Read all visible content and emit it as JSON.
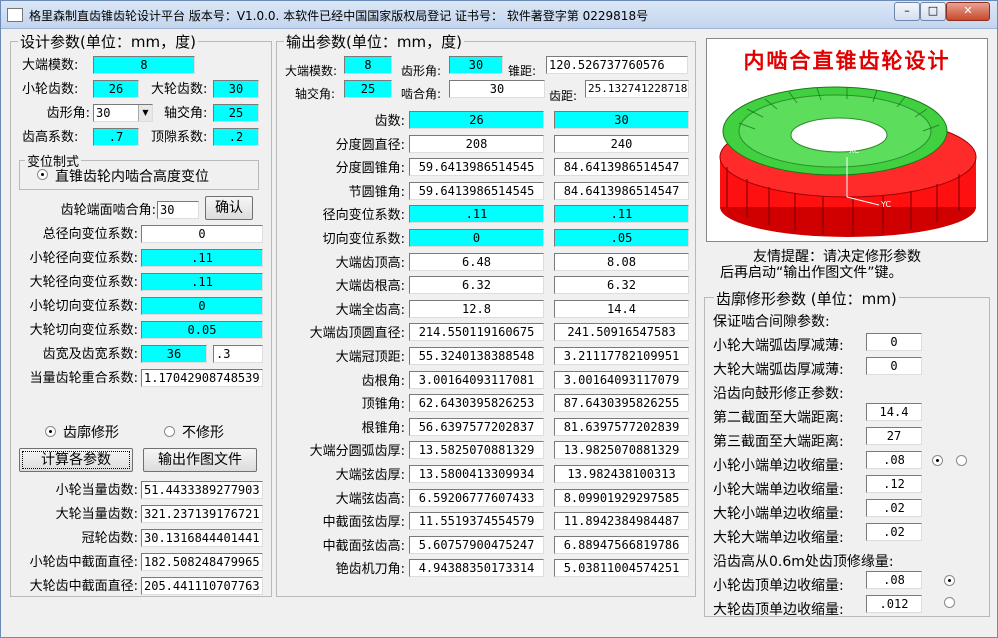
{
  "window": {
    "title": "格里森制直齿锥齿轮设计平台  版本号：V1.0.0.    本软件已经中国国家版权局登记  证书号：  软件著登字第 0229818号",
    "min": "–",
    "max": "□",
    "close": "✕"
  },
  "design": {
    "title": "设计参数(单位：mm，度)",
    "module_label": "大端模数:",
    "module": "8",
    "z1_label": "小轮齿数:",
    "z1": "26",
    "z2_label": "大轮齿数:",
    "z2": "30",
    "alpha_label": "齿形角:",
    "alpha": "30",
    "sigma_label": "轴交角:",
    "sigma": "25",
    "ha_label": "齿高系数:",
    "ha": ".7",
    "c_label": "顶隙系数:",
    "c": ".2",
    "mod_group": "变位制式",
    "mod_option": "直锥齿轮内啮合高度变位",
    "mesh_angle_label": "齿轮端面啮合角:",
    "mesh_angle": "30",
    "confirm": "确认",
    "x_total_label": "总径向变位系数:",
    "x_total": "0",
    "x1_label": "小轮径向变位系数:",
    "x1": ".11",
    "x2_label": "大轮径向变位系数:",
    "x2": ".11",
    "xt1_label": "小轮切向变位系数:",
    "xt1": "0",
    "xt2_label": "大轮切向变位系数:",
    "xt2": "0.05",
    "width_label": "齿宽及齿宽系数:",
    "width": "36",
    "width_coef": ".3",
    "eps_label": "当量齿轮重合系数:",
    "eps": "1.17042908748539",
    "opt_mod": "齿廓修形",
    "opt_nomod": "不修形",
    "calc": "计算各参数",
    "export": "输出作图文件",
    "zv1_label": "小轮当量齿数:",
    "zv1": "51.4433389277903",
    "zv2_label": "大轮当量齿数:",
    "zv2": "321.237139176721",
    "zc_label": "冠轮齿数:",
    "zc": "30.1316844401441",
    "dm1_label": "小轮齿中截面直径:",
    "dm1": "182.508248479965",
    "dm2_label": "大轮齿中截面直径:",
    "dm2": "205.441110707763"
  },
  "output": {
    "title": "输出参数(单位：mm，度)",
    "m_label": "大端模数:",
    "m": "8",
    "a_label": "齿形角:",
    "a": "30",
    "cone_label": "锥距:",
    "cone": "120.526737760576",
    "s_label": "轴交角:",
    "s": "25",
    "mesh_label": "啮合角:",
    "mesh": "30",
    "pitch_label": "齿距:",
    "pitch": "25.1327412287183",
    "rows": [
      {
        "label": "齿数:",
        "v1": "26",
        "v2": "30",
        "cyan": true
      },
      {
        "label": "分度圆直径:",
        "v1": "208",
        "v2": "240",
        "cyan": false
      },
      {
        "label": "分度圆锥角:",
        "v1": "59.6413986514545",
        "v2": "84.6413986514547",
        "cyan": false
      },
      {
        "label": "节圆锥角:",
        "v1": "59.6413986514545",
        "v2": "84.6413986514547",
        "cyan": false
      },
      {
        "label": "径向变位系数:",
        "v1": ".11",
        "v2": ".11",
        "cyan": true
      },
      {
        "label": "切向变位系数:",
        "v1": "0",
        "v2": ".05",
        "cyan": true
      },
      {
        "label": "大端齿顶高:",
        "v1": "6.48",
        "v2": "8.08",
        "cyan": false
      },
      {
        "label": "大端齿根高:",
        "v1": "6.32",
        "v2": "6.32",
        "cyan": false
      },
      {
        "label": "大端全齿高:",
        "v1": "12.8",
        "v2": "14.4",
        "cyan": false
      },
      {
        "label": "大端齿顶圆直径:",
        "v1": "214.550119160675",
        "v2": "241.50916547583",
        "cyan": false
      },
      {
        "label": "大端冠顶距:",
        "v1": "55.3240138388548",
        "v2": "3.21117782109951",
        "cyan": false
      },
      {
        "label": "齿根角:",
        "v1": "3.00164093117081",
        "v2": "3.00164093117079",
        "cyan": false
      },
      {
        "label": "顶锥角:",
        "v1": "62.6430395826253",
        "v2": "87.6430395826255",
        "cyan": false
      },
      {
        "label": "根锥角:",
        "v1": "56.6397577202837",
        "v2": "81.6397577202839",
        "cyan": false
      },
      {
        "label": "大端分圆弧齿厚:",
        "v1": "13.5825070881329",
        "v2": "13.9825070881329",
        "cyan": false
      },
      {
        "label": "大端弦齿厚:",
        "v1": "13.5800413309934",
        "v2": "13.982438100313",
        "cyan": false
      },
      {
        "label": "大端弦齿高:",
        "v1": "6.59206777607433",
        "v2": "8.09901929297585",
        "cyan": false
      },
      {
        "label": "中截面弦齿厚:",
        "v1": "11.5519374554579",
        "v2": "11.8942384984487",
        "cyan": false
      },
      {
        "label": "中截面弦齿高:",
        "v1": "5.60757900475247",
        "v2": "6.88947566819786",
        "cyan": false
      },
      {
        "label": "铯齿机刀角:",
        "v1": "4.94388350173314",
        "v2": "5.03811004574251",
        "cyan": false
      }
    ]
  },
  "preview": {
    "title": "内啮合直锥齿轮设计"
  },
  "hint": {
    "line1": "友情提醒：请决定修形参数",
    "line2": "后再启动“输出作图文件”键。"
  },
  "profile": {
    "title": "齿廓修形参数 (单位：mm)",
    "sec1": "保证啮合间隙参数:",
    "p1_label": "小轮大端弧齿厚减薄:",
    "p1": "0",
    "p2_label": "大轮大端弧齿厚减薄:",
    "p2": "0",
    "sec2": "沿齿向鼓形修正参数:",
    "p3_label": "第二截面至大端距离:",
    "p3": "14.4",
    "p4_label": "第三截面至大端距离:",
    "p4": "27",
    "p5_label": "小轮小端单边收缩量:",
    "p5": ".08",
    "p6_label": "小轮大端单边收缩量:",
    "p6": ".12",
    "p7_label": "大轮小端单边收缩量:",
    "p7": ".02",
    "p8_label": "大轮大端单边收缩量:",
    "p8": ".02",
    "sec3": "沿齿高从0.6m处齿顶修缘量:",
    "p9_label": "小轮齿顶单边收缩量:",
    "p9": ".08",
    "p10_label": "大轮齿顶单边收缩量:",
    "p10": ".012"
  }
}
